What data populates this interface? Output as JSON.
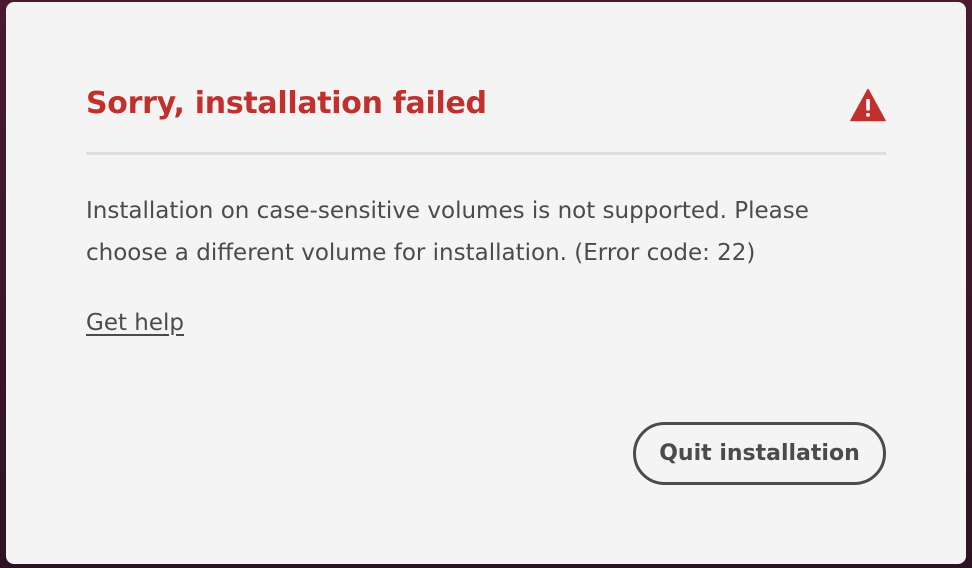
{
  "dialog": {
    "title": "Sorry, installation failed",
    "alert_icon": "warning-triangle-icon",
    "message": "Installation on case-sensitive volumes is not supported. Please choose a different volume for installation. (Error code: 22)",
    "help_link_label": "Get help",
    "quit_button_label": "Quit installation"
  },
  "colors": {
    "title": "#c0312e",
    "text": "#4b4b4b",
    "dialog_bg": "#f4f4f4",
    "divider": "#dedede"
  }
}
